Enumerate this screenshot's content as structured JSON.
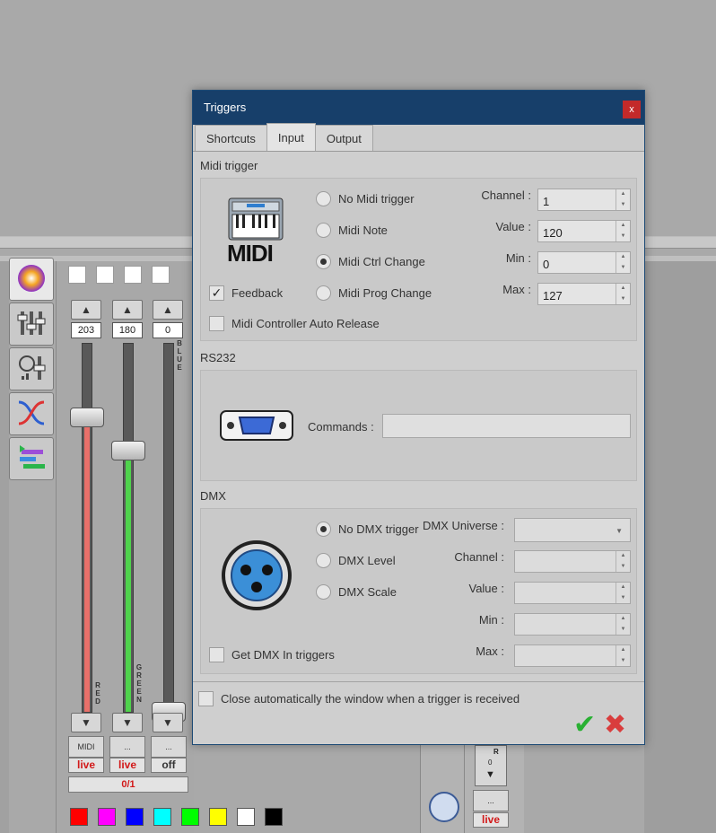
{
  "dialog": {
    "title": "Triggers",
    "close_label": "x",
    "tabs": [
      "Shortcuts",
      "Input",
      "Output"
    ],
    "active_tab": "Input",
    "midi": {
      "section_title": "Midi trigger",
      "logo_text": "MIDI",
      "options": [
        "No Midi trigger",
        "Midi Note",
        "Midi Ctrl Change",
        "Midi Prog Change"
      ],
      "selected_option": "Midi Ctrl Change",
      "feedback_label": "Feedback",
      "feedback_checked": true,
      "auto_release_label": "Midi Controller Auto Release",
      "auto_release_checked": false,
      "fields": {
        "channel_label": "Channel :",
        "channel_value": "1",
        "value_label": "Value :",
        "value_value": "120",
        "min_label": "Min :",
        "min_value": "0",
        "max_label": "Max :",
        "max_value": "127"
      }
    },
    "rs232": {
      "section_title": "RS232",
      "commands_label": "Commands :",
      "commands_value": ""
    },
    "dmx": {
      "section_title": "DMX",
      "options": [
        "No DMX trigger",
        "DMX Level",
        "DMX Scale"
      ],
      "selected_option": "No DMX trigger",
      "get_in_label": "Get DMX In triggers",
      "get_in_checked": false,
      "fields": {
        "universe_label": "DMX Universe :",
        "channel_label": "Channel :",
        "value_label": "Value :",
        "min_label": "Min :",
        "max_label": "Max :"
      }
    },
    "close_auto_label": "Close automatically the window when a trigger is received",
    "close_auto_checked": false
  },
  "background": {
    "faders": [
      {
        "value": "203",
        "label": "RED",
        "color": "#e8706a",
        "level": 0.8,
        "foot_label": "MIDI",
        "status": "live"
      },
      {
        "value": "180",
        "label": "GREEN",
        "color": "#4fd34c",
        "level": 0.71,
        "foot_label": "...",
        "status": "live"
      },
      {
        "value": "0",
        "label": "BLUE",
        "color": "#4a7be0",
        "level": 0.0,
        "foot_label": "...",
        "status": "off"
      }
    ],
    "page_indicator": "0/1",
    "palette": [
      "#ff0000",
      "#ff00ff",
      "#0000ff",
      "#00ffff",
      "#00ff00",
      "#ffff00",
      "#ffffff",
      "#000000"
    ],
    "right_channel": {
      "value": "0",
      "label": "R",
      "foot_label": "...",
      "status": "live"
    }
  }
}
